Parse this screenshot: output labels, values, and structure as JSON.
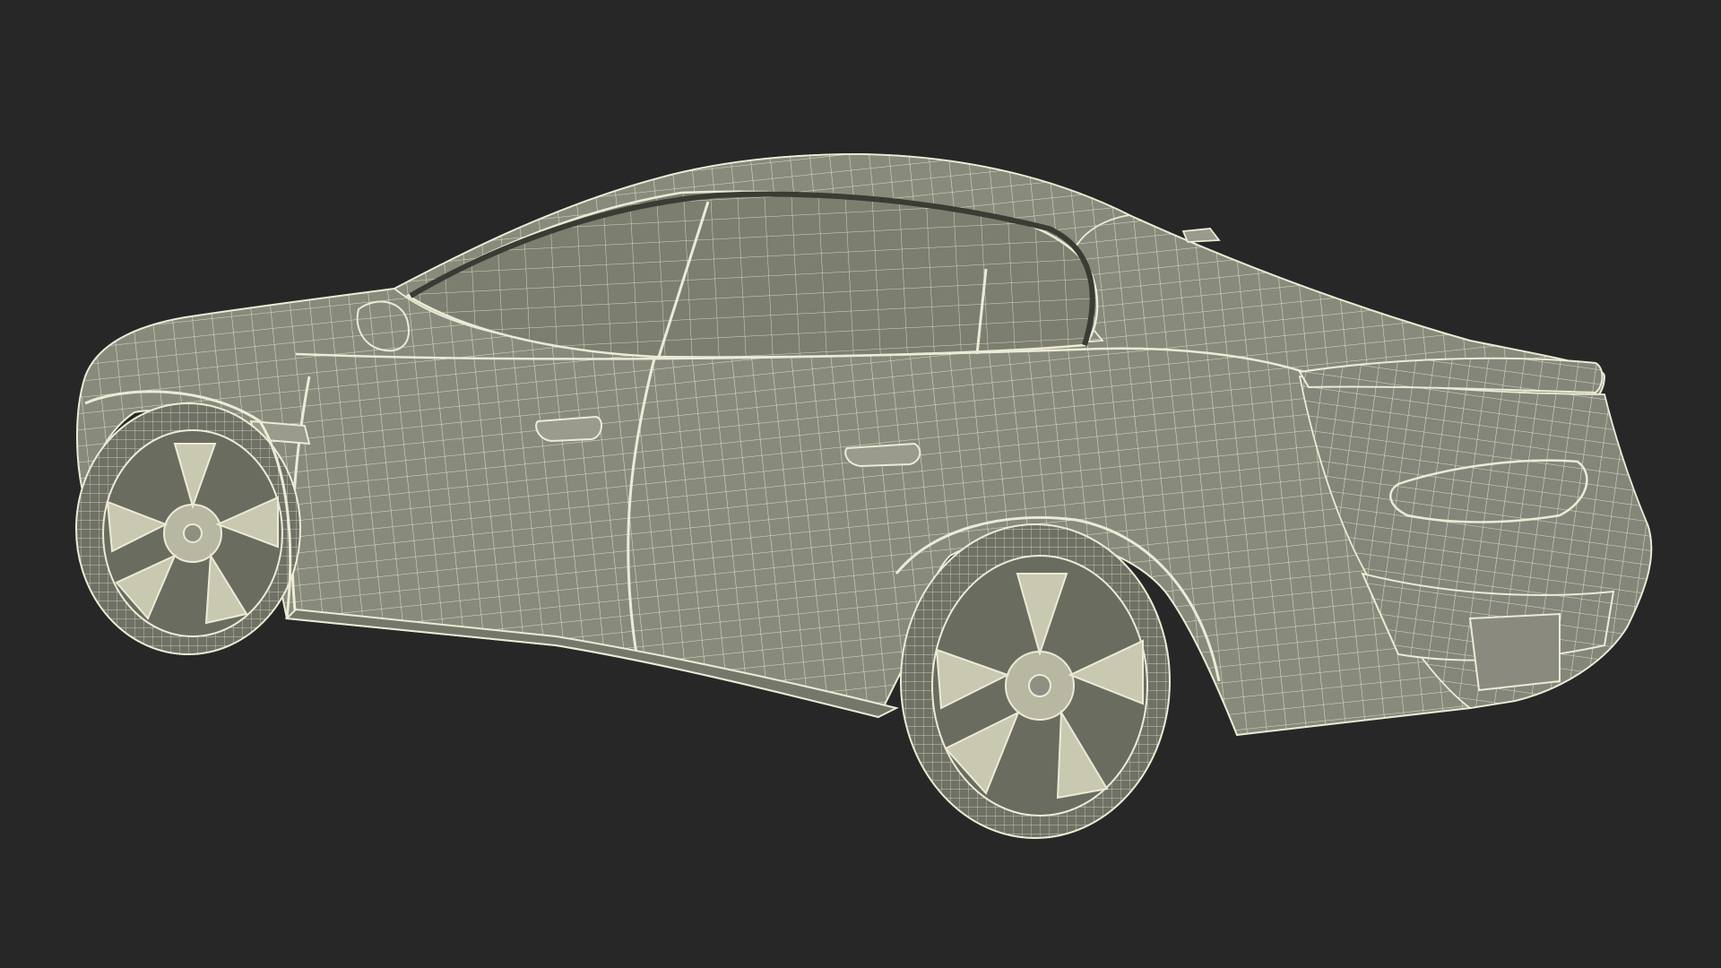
{
  "scene": {
    "subject": "car-wireframe-render",
    "background_color": "#272727",
    "body_color": "#888a7c",
    "wire_color": "#ecebd6",
    "shadow_color": "#5a5c52",
    "glass_color": "#7c7e70"
  }
}
